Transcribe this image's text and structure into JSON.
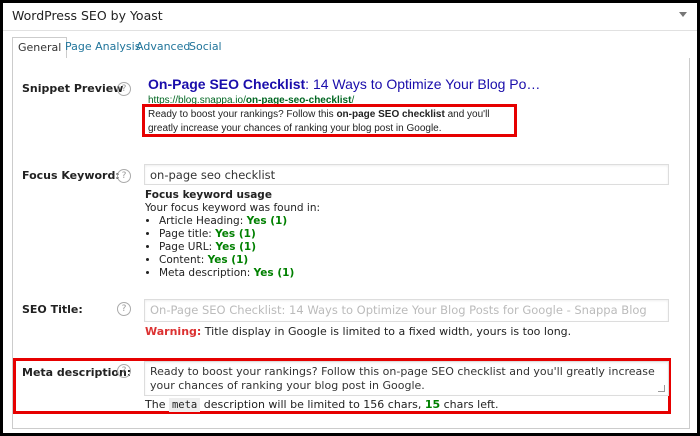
{
  "box": {
    "title": "WordPress SEO by Yoast"
  },
  "tabs": [
    {
      "label": "General"
    },
    {
      "label": "Page Analysis"
    },
    {
      "label": "Advanced"
    },
    {
      "label": "Social"
    }
  ],
  "snippet": {
    "label": "Snippet Preview",
    "title_bold": "On-Page SEO Checklist",
    "title_rest": ": 14 Ways to Optimize Your Blog Po…",
    "url_prefix": "https://blog.snappa.io/",
    "url_slug": "on-page-seo-checklist",
    "url_suffix": "/",
    "desc_pre": "Ready to boost your rankings? Follow this ",
    "desc_bold": "on-page SEO checklist",
    "desc_post": " and you'll greatly increase your chances of ranking your blog post in Google."
  },
  "focus": {
    "label": "Focus Keyword:",
    "value": "on-page seo checklist",
    "usage_heading": "Focus keyword usage",
    "usage_intro": "Your focus keyword was found in:",
    "items": [
      {
        "label": "Article Heading: ",
        "value": "Yes (1)"
      },
      {
        "label": "Page title: ",
        "value": "Yes (1)"
      },
      {
        "label": "Page URL: ",
        "value": "Yes (1)"
      },
      {
        "label": "Content: ",
        "value": "Yes (1)"
      },
      {
        "label": "Meta description: ",
        "value": "Yes (1)"
      }
    ]
  },
  "seo_title": {
    "label": "SEO Title:",
    "placeholder": "On-Page SEO Checklist: 14 Ways to Optimize Your Blog Posts for Google  - Snappa Blog",
    "warning_label": "Warning:",
    "warning_text": " Title display in Google is limited to a fixed width, yours is too long."
  },
  "meta": {
    "label": "Meta description:",
    "value": "Ready to boost your rankings? Follow this on-page SEO checklist and you'll greatly increase your chances of ranking your blog post in Google.",
    "note_pre": "The ",
    "note_code": "meta",
    "note_mid": " description will be limited to 156 chars, ",
    "note_count": "15",
    "note_post": " chars left."
  },
  "help_icon": "?",
  "colors": {
    "warning": "#dc3232",
    "highlight": "#e60000",
    "success": "#008000",
    "link": "#1a0dab"
  }
}
